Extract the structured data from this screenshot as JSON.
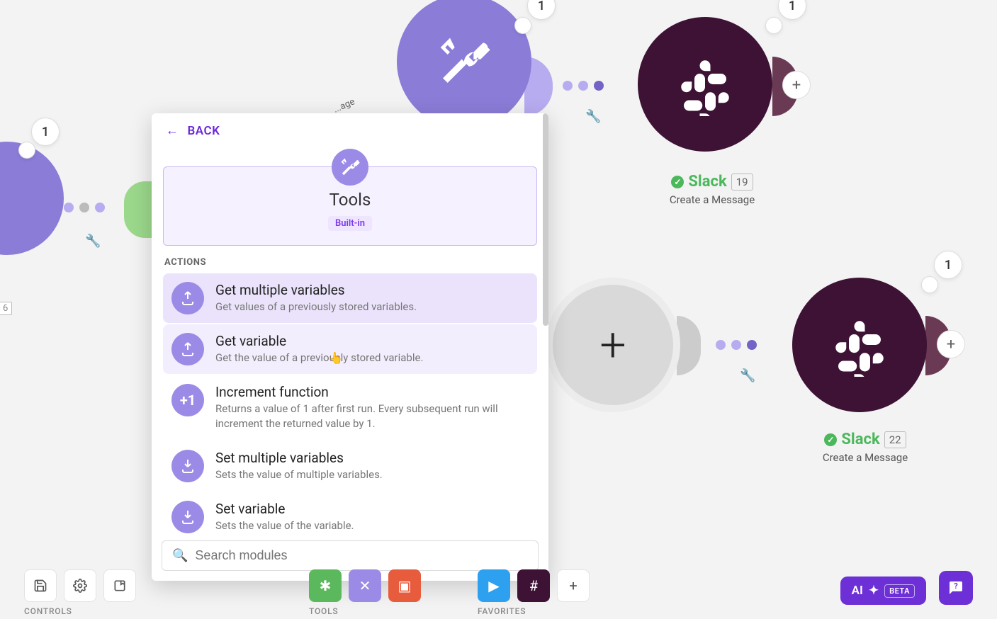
{
  "canvas": {
    "bubbles": {
      "b1": "1",
      "b2": "1",
      "b3": "1",
      "b4": "1"
    },
    "side_num": "6",
    "slack1": {
      "app": "Slack",
      "num": "19",
      "subtitle": "Create a Message"
    },
    "slack2": {
      "app": "Slack",
      "num": "22",
      "subtitle": "Create a Message"
    },
    "partial_label": "...age"
  },
  "panel": {
    "back": "BACK",
    "header": {
      "title": "Tools",
      "badge": "Built-in"
    },
    "section": "ACTIONS",
    "actions": [
      {
        "title": "Get multiple variables",
        "desc": "Get values of a previously stored variables."
      },
      {
        "title": "Get variable",
        "desc": "Get the value of a previously stored variable."
      },
      {
        "title": "Increment function",
        "desc": "Returns a value of 1 after first run. Every subsequent run will increment the returned value by 1."
      },
      {
        "title": "Set multiple variables",
        "desc": "Sets the value of multiple variables."
      },
      {
        "title": "Set variable",
        "desc": "Sets the value of the variable."
      }
    ],
    "increment_icon": "+1",
    "search_placeholder": "Search modules"
  },
  "bottom": {
    "controls": "CONTROLS",
    "tools": "TOOLS",
    "favorites": "FAVORITES",
    "ai": "AI",
    "beta": "BETA"
  }
}
